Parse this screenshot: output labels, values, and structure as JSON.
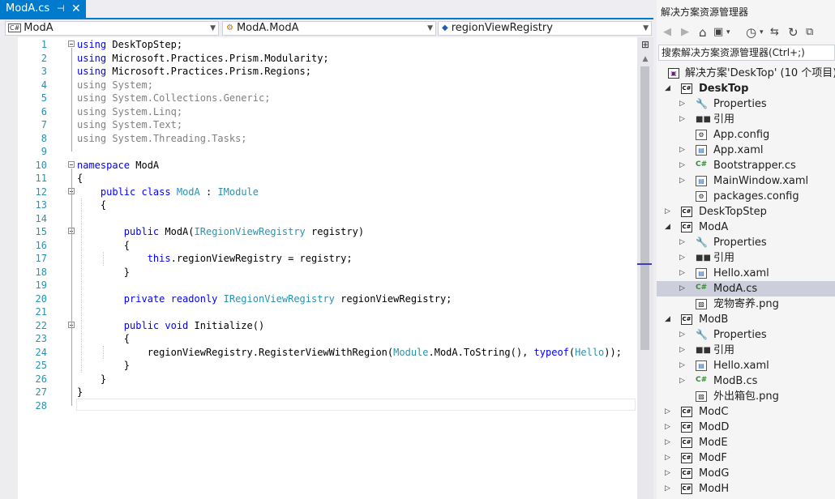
{
  "editor": {
    "tab": {
      "title": "ModA.cs",
      "pin": "⊣",
      "close": "✕"
    },
    "nav": {
      "project": "ModA",
      "type": "ModA.ModA",
      "member": "regionViewRegistry"
    },
    "lines": [
      {
        "n": "1",
        "segs": [
          {
            "c": "kw",
            "t": "using"
          },
          {
            "c": "",
            "t": " DeskTopStep;"
          }
        ]
      },
      {
        "n": "2",
        "segs": [
          {
            "c": "kw",
            "t": "using"
          },
          {
            "c": "",
            "t": " Microsoft.Practices.Prism.Modularity;"
          }
        ]
      },
      {
        "n": "3",
        "segs": [
          {
            "c": "kw",
            "t": "using"
          },
          {
            "c": "",
            "t": " Microsoft.Practices.Prism.Regions;"
          }
        ]
      },
      {
        "n": "4",
        "segs": [
          {
            "c": "dim",
            "t": "using System;"
          }
        ]
      },
      {
        "n": "5",
        "segs": [
          {
            "c": "dim",
            "t": "using System.Collections.Generic;"
          }
        ]
      },
      {
        "n": "6",
        "segs": [
          {
            "c": "dim",
            "t": "using System.Linq;"
          }
        ]
      },
      {
        "n": "7",
        "segs": [
          {
            "c": "dim",
            "t": "using System.Text;"
          }
        ]
      },
      {
        "n": "8",
        "segs": [
          {
            "c": "dim",
            "t": "using System.Threading.Tasks;"
          }
        ]
      },
      {
        "n": "9",
        "segs": []
      },
      {
        "n": "10",
        "segs": [
          {
            "c": "kw",
            "t": "namespace"
          },
          {
            "c": "",
            "t": " ModA"
          }
        ]
      },
      {
        "n": "11",
        "segs": [
          {
            "c": "",
            "t": "{"
          }
        ]
      },
      {
        "n": "12",
        "segs": [
          {
            "c": "",
            "t": "    "
          },
          {
            "c": "kw",
            "t": "public class"
          },
          {
            "c": "",
            "t": " "
          },
          {
            "c": "ty",
            "t": "ModA"
          },
          {
            "c": "",
            "t": " : "
          },
          {
            "c": "ty",
            "t": "IModule"
          }
        ]
      },
      {
        "n": "13",
        "segs": [
          {
            "c": "",
            "t": "    {"
          }
        ]
      },
      {
        "n": "14",
        "segs": []
      },
      {
        "n": "15",
        "segs": [
          {
            "c": "",
            "t": "        "
          },
          {
            "c": "kw",
            "t": "public"
          },
          {
            "c": "",
            "t": " ModA("
          },
          {
            "c": "ty",
            "t": "IRegionViewRegistry"
          },
          {
            "c": "",
            "t": " registry)"
          }
        ]
      },
      {
        "n": "16",
        "segs": [
          {
            "c": "",
            "t": "        {"
          }
        ]
      },
      {
        "n": "17",
        "segs": [
          {
            "c": "",
            "t": "            "
          },
          {
            "c": "kw",
            "t": "this"
          },
          {
            "c": "",
            "t": ".regionViewRegistry = registry;"
          }
        ]
      },
      {
        "n": "18",
        "segs": [
          {
            "c": "",
            "t": "        }"
          }
        ]
      },
      {
        "n": "19",
        "segs": []
      },
      {
        "n": "20",
        "segs": [
          {
            "c": "",
            "t": "        "
          },
          {
            "c": "kw",
            "t": "private readonly"
          },
          {
            "c": "",
            "t": " "
          },
          {
            "c": "ty",
            "t": "IRegionViewRegistry"
          },
          {
            "c": "",
            "t": " regionViewRegistry;"
          }
        ]
      },
      {
        "n": "21",
        "segs": []
      },
      {
        "n": "22",
        "segs": [
          {
            "c": "",
            "t": "        "
          },
          {
            "c": "kw",
            "t": "public void"
          },
          {
            "c": "",
            "t": " Initialize()"
          }
        ]
      },
      {
        "n": "23",
        "segs": [
          {
            "c": "",
            "t": "        {"
          }
        ]
      },
      {
        "n": "24",
        "segs": [
          {
            "c": "",
            "t": "            regionViewRegistry.RegisterViewWithRegion("
          },
          {
            "c": "ty",
            "t": "Module"
          },
          {
            "c": "",
            "t": ".ModA.ToString(), "
          },
          {
            "c": "kw",
            "t": "typeof"
          },
          {
            "c": "",
            "t": "("
          },
          {
            "c": "ty",
            "t": "Hello"
          },
          {
            "c": "",
            "t": "));"
          }
        ]
      },
      {
        "n": "25",
        "segs": [
          {
            "c": "",
            "t": "        }"
          }
        ]
      },
      {
        "n": "26",
        "segs": [
          {
            "c": "",
            "t": "    }"
          }
        ]
      },
      {
        "n": "27",
        "segs": [
          {
            "c": "",
            "t": "}"
          }
        ]
      },
      {
        "n": "28",
        "segs": []
      }
    ],
    "folds": [
      "1",
      "10",
      "12",
      "15",
      "22"
    ]
  },
  "solution_explorer": {
    "title": "解决方案资源管理器",
    "toolbar": {
      "back": "◀",
      "forward": "▶",
      "home": "⌂",
      "sync": "⇆",
      "refresh": "↻",
      "history": "◷",
      "dropdown": "▾",
      "collapse": "⧉"
    },
    "search_placeholder": "搜索解决方案资源管理器(Ctrl+;)",
    "tree": [
      {
        "label": "解决方案'DeskTop' (10 个项目)",
        "icon": "solution",
        "exp": "",
        "level": 0,
        "bold": false
      },
      {
        "label": "DeskTop",
        "icon": "csproj",
        "exp": "◢",
        "level": 1,
        "bold": true
      },
      {
        "label": "Properties",
        "icon": "wrench",
        "exp": "▷",
        "level": 2
      },
      {
        "label": "引用",
        "icon": "ref",
        "exp": "▷",
        "level": 2
      },
      {
        "label": "App.config",
        "icon": "config",
        "exp": "",
        "level": 2
      },
      {
        "label": "App.xaml",
        "icon": "xaml",
        "exp": "▷",
        "level": 2
      },
      {
        "label": "Bootstrapper.cs",
        "icon": "csfile",
        "exp": "▷",
        "level": 2
      },
      {
        "label": "MainWindow.xaml",
        "icon": "xaml",
        "exp": "▷",
        "level": 2
      },
      {
        "label": "packages.config",
        "icon": "config",
        "exp": "",
        "level": 2
      },
      {
        "label": "DeskTopStep",
        "icon": "csproj",
        "exp": "▷",
        "level": 1
      },
      {
        "label": "ModA",
        "icon": "csproj",
        "exp": "◢",
        "level": 1
      },
      {
        "label": "Properties",
        "icon": "wrench",
        "exp": "▷",
        "level": 2
      },
      {
        "label": "引用",
        "icon": "ref",
        "exp": "▷",
        "level": 2
      },
      {
        "label": "Hello.xaml",
        "icon": "xaml",
        "exp": "▷",
        "level": 2
      },
      {
        "label": "ModA.cs",
        "icon": "csfile",
        "exp": "▷",
        "level": 2,
        "selected": true
      },
      {
        "label": "宠物寄养.png",
        "icon": "image",
        "exp": "",
        "level": 2
      },
      {
        "label": "ModB",
        "icon": "csproj",
        "exp": "◢",
        "level": 1
      },
      {
        "label": "Properties",
        "icon": "wrench",
        "exp": "▷",
        "level": 2
      },
      {
        "label": "引用",
        "icon": "ref",
        "exp": "▷",
        "level": 2
      },
      {
        "label": "Hello.xaml",
        "icon": "xaml",
        "exp": "▷",
        "level": 2
      },
      {
        "label": "ModB.cs",
        "icon": "csfile",
        "exp": "▷",
        "level": 2
      },
      {
        "label": "外出箱包.png",
        "icon": "image",
        "exp": "",
        "level": 2
      },
      {
        "label": "ModC",
        "icon": "csproj",
        "exp": "▷",
        "level": 1
      },
      {
        "label": "ModD",
        "icon": "csproj",
        "exp": "▷",
        "level": 1
      },
      {
        "label": "ModE",
        "icon": "csproj",
        "exp": "▷",
        "level": 1
      },
      {
        "label": "ModF",
        "icon": "csproj",
        "exp": "▷",
        "level": 1
      },
      {
        "label": "ModG",
        "icon": "csproj",
        "exp": "▷",
        "level": 1
      },
      {
        "label": "ModH",
        "icon": "csproj",
        "exp": "▷",
        "level": 1
      }
    ]
  },
  "colors": {
    "accent": "#007acc",
    "keyword": "#0000ff",
    "type": "#2b91af",
    "dim": "#808080",
    "selection": "#cccedb"
  }
}
